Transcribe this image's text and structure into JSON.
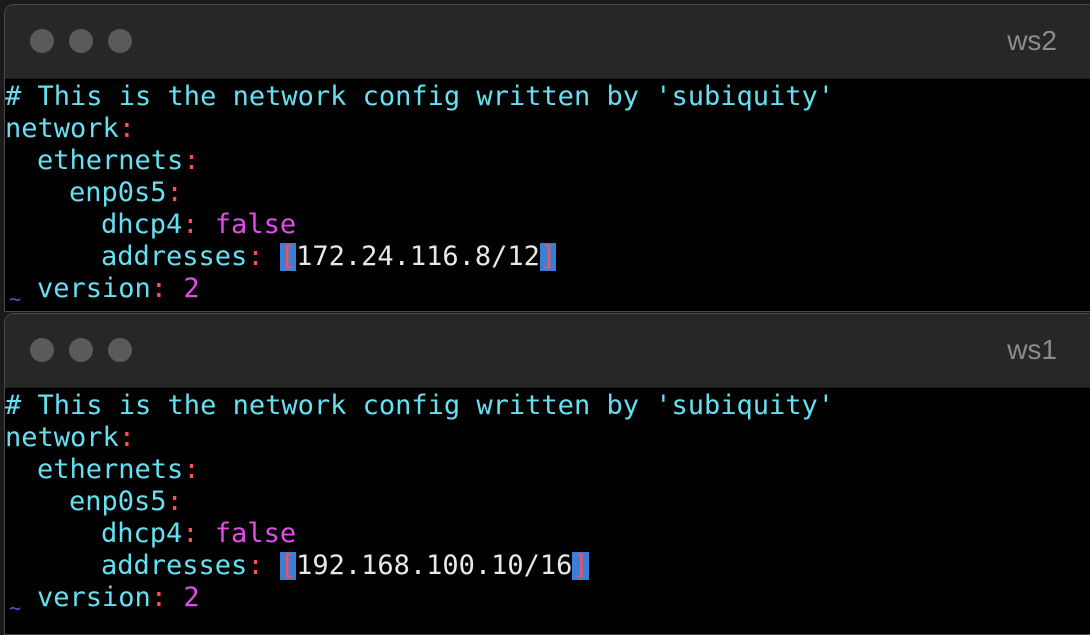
{
  "windows": [
    {
      "title": "ws2",
      "comment": "# This is the network config written by 'subiquity'",
      "network_key": "network",
      "ethernets_key": "ethernets",
      "interface_key": "enp0s5",
      "dhcp4_key": "dhcp4",
      "dhcp4_value": "false",
      "addresses_key": "addresses",
      "bracket_open": "[",
      "address": "172.24.116.8/12",
      "bracket_close": "]",
      "version_key": "version",
      "version_value": "2",
      "tilde": "~"
    },
    {
      "title": "ws1",
      "comment": "# This is the network config written by 'subiquity'",
      "network_key": "network",
      "ethernets_key": "ethernets",
      "interface_key": "enp0s5",
      "dhcp4_key": "dhcp4",
      "dhcp4_value": "false",
      "addresses_key": "addresses",
      "bracket_open": "[",
      "address": "192.168.100.10/16",
      "bracket_close": "]",
      "version_key": "version",
      "version_value": "2",
      "tilde": "~"
    }
  ],
  "colors": {
    "background": "#000000",
    "titlebar": "#272727",
    "key": "#66e0f0",
    "colon": "#ff4d5a",
    "value": "#e24ce8",
    "cursor": "#3a7ed6"
  }
}
